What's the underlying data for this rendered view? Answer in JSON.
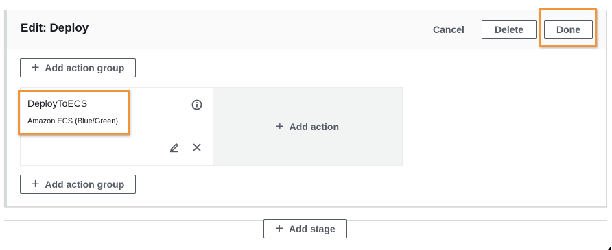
{
  "stage": {
    "title": "Edit: Deploy",
    "cancel_label": "Cancel",
    "delete_label": "Delete",
    "done_label": "Done"
  },
  "add_action_group_label": "Add action group",
  "action": {
    "name": "DeployToECS",
    "provider": "Amazon ECS (Blue/Green)",
    "icons": [
      "info-icon",
      "edit-icon",
      "close-icon"
    ]
  },
  "add_action_label": "Add action",
  "add_stage_label": "Add stage",
  "colors": {
    "highlight": "#f0953a",
    "button_text": "#545b64",
    "title_text": "#16191f",
    "add_action_background": "#f2f3f3"
  }
}
